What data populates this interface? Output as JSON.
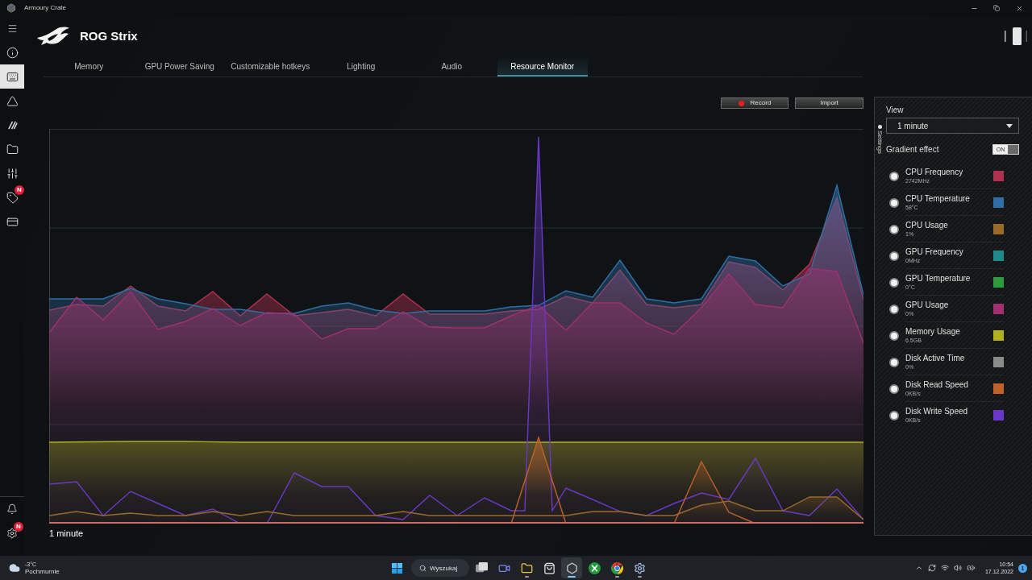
{
  "window": {
    "title": "Armoury Crate"
  },
  "sidebar": {
    "items": [
      {
        "selected": false
      },
      {
        "selected": true
      },
      {
        "selected": false
      },
      {
        "selected": false
      },
      {
        "selected": false
      },
      {
        "selected": false
      },
      {
        "selected": false,
        "badge": "N"
      },
      {
        "selected": false
      }
    ],
    "bottom_items": [
      {
        "selected": false
      },
      {
        "selected": false,
        "badge": "N"
      }
    ]
  },
  "header": {
    "title": "ROG Strix"
  },
  "tabs": [
    {
      "label": "Memory",
      "selected": false
    },
    {
      "label": "GPU Power Saving",
      "selected": false
    },
    {
      "label": "Customizable hotkeys",
      "selected": false
    },
    {
      "label": "Lighting",
      "selected": false
    },
    {
      "label": "Audio",
      "selected": false
    },
    {
      "label": "Resource Monitor",
      "selected": true
    }
  ],
  "toolbar": {
    "buttons": [
      {
        "label": "Record",
        "kind": "record"
      },
      {
        "label": "Import",
        "kind": "plain"
      }
    ]
  },
  "chart": {
    "caption": "1 minute"
  },
  "settings_panel": {
    "tab_label": "Settings",
    "view_label": "View",
    "view_value": "1 minute",
    "gradient_effect": {
      "label": "Gradient effect",
      "on": true,
      "text": "ON"
    },
    "metrics": [
      {
        "name": "CPU Frequency",
        "value": "2742MHz",
        "color": "#b0304f",
        "on": true
      },
      {
        "name": "CPU Temperature",
        "value": "58°C",
        "color": "#2f6fa8",
        "on": true
      },
      {
        "name": "CPU Usage",
        "value": "1%",
        "color": "#9a6a2a",
        "on": true
      },
      {
        "name": "GPU Frequency",
        "value": "0MHz",
        "color": "#1e8a8a",
        "on": true
      },
      {
        "name": "GPU Temperature",
        "value": "0°C",
        "color": "#2e9a3e",
        "on": true
      },
      {
        "name": "GPU Usage",
        "value": "0%",
        "color": "#a0306e",
        "on": true
      },
      {
        "name": "Memory Usage",
        "value": "6.5GB",
        "color": "#b0b020",
        "on": true
      },
      {
        "name": "Disk Active Time",
        "value": "0%",
        "color": "#8a8a8a",
        "on": true
      },
      {
        "name": "Disk Read Speed",
        "value": "0KB/s",
        "color": "#c0602a",
        "on": true
      },
      {
        "name": "Disk Write Speed",
        "value": "0KB/s",
        "color": "#6a38c8",
        "on": true
      }
    ]
  },
  "taskbar": {
    "weather": {
      "temperature": "-3°C",
      "condition": "Pochmurnie"
    },
    "search": {
      "placeholder": "Wyszukaj"
    },
    "apps": [
      {
        "running": false,
        "focused": false
      },
      {
        "running": false,
        "focused": false
      },
      {
        "running": true,
        "focused": false
      },
      {
        "running": false,
        "focused": false
      },
      {
        "running": true,
        "focused": true
      },
      {
        "running": false,
        "focused": false
      },
      {
        "running": true,
        "focused": false
      },
      {
        "running": true,
        "focused": false
      }
    ],
    "clock": {
      "time": "10:54",
      "date": "17.12.2022"
    },
    "notifications": "1"
  }
}
